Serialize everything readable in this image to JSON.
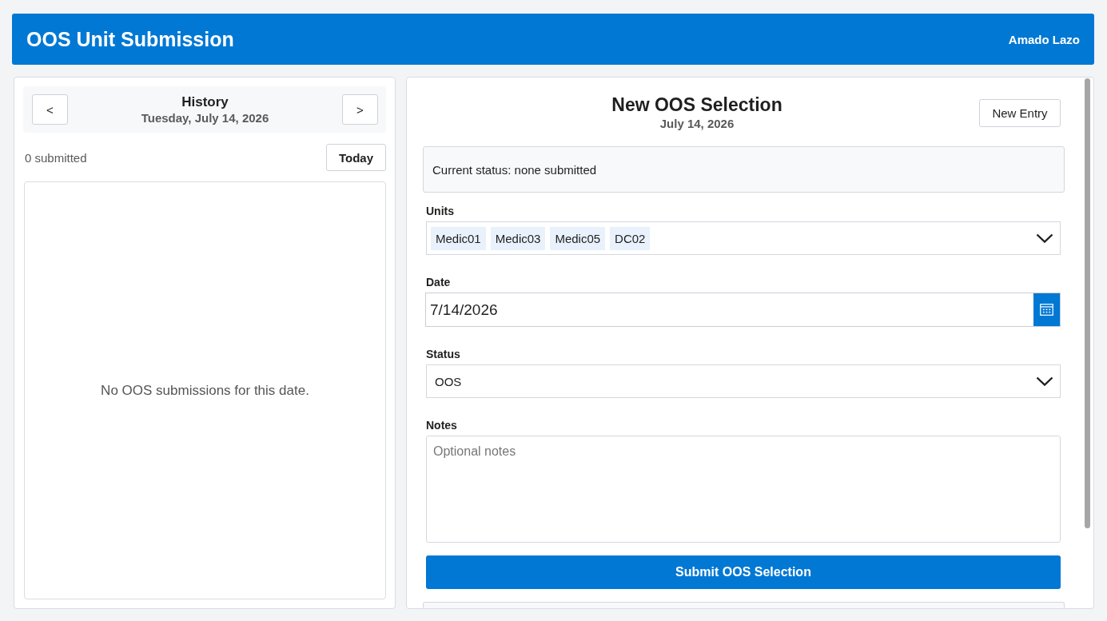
{
  "header": {
    "title": "OOS Unit Submission",
    "user": "Amado Lazo"
  },
  "history": {
    "title": "History",
    "date": "Tuesday, July 14, 2026",
    "prev_button": "<",
    "next_button": ">",
    "count": "0 submitted",
    "today_button": "Today",
    "empty_message": "No OOS submissions for this date."
  },
  "form": {
    "title": "New OOS Selection",
    "date": "July 14, 2026",
    "new_entry_button": "New Entry",
    "status_message": "Current status: none submitted",
    "fields": [
      {
        "kind": "multiselect",
        "label": "Units",
        "chips": [
          "Medic01",
          "Medic03",
          "Medic05",
          "DC02"
        ]
      },
      {
        "kind": "date",
        "label": "Date",
        "value": "7/14/2026"
      },
      {
        "kind": "select",
        "label": "Status",
        "value": "OOS"
      },
      {
        "kind": "textarea",
        "label": "Notes",
        "placeholder": "Optional notes"
      }
    ],
    "submit_button": "Submit OOS Selection"
  }
}
